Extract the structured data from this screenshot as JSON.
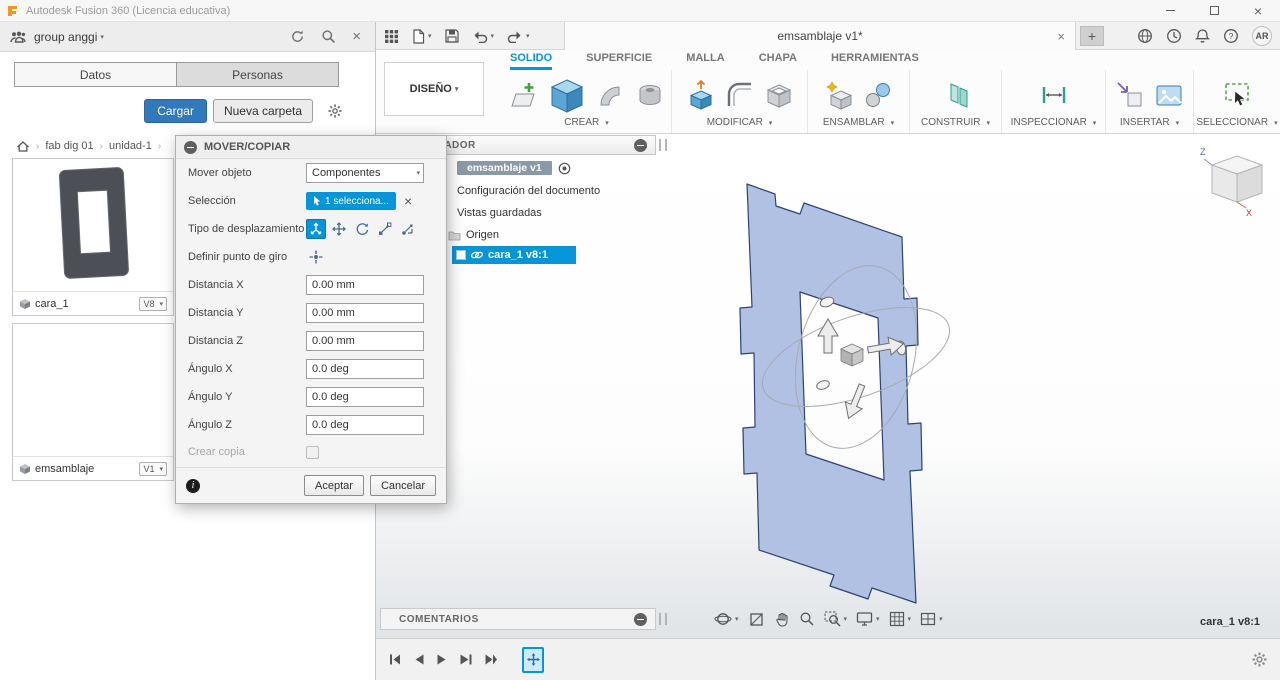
{
  "titlebar": {
    "app_title": "Autodesk Fusion 360 (Licencia educativa)"
  },
  "data_panel": {
    "team_name": "group anggi",
    "tabs": [
      {
        "label": "Datos",
        "active": true
      },
      {
        "label": "Personas",
        "active": false
      }
    ],
    "upload_button": "Cargar",
    "new_folder_button": "Nueva carpeta",
    "breadcrumb": [
      {
        "label": "fab dig 01"
      },
      {
        "label": "unidad-1"
      }
    ],
    "items": [
      {
        "name": "cara_1",
        "version": "V8"
      },
      {
        "name": "emsamblaje",
        "version": "V1"
      }
    ]
  },
  "appbar": {
    "document_tab": "emsamblaje v1*",
    "new_tab_button": "+",
    "avatar_initials": "AR"
  },
  "ribbon": {
    "workspace_selector": "DISEÑO",
    "tabs": [
      {
        "label": "SOLIDO",
        "active": true
      },
      {
        "label": "SUPERFICIE"
      },
      {
        "label": "MALLA"
      },
      {
        "label": "CHAPA"
      },
      {
        "label": "HERRAMIENTAS"
      }
    ],
    "groups": [
      {
        "label": "CREAR"
      },
      {
        "label": "MODIFICAR"
      },
      {
        "label": "ENSAMBLAR"
      },
      {
        "label": "CONSTRUIR"
      },
      {
        "label": "INSPECCIONAR"
      },
      {
        "label": "INSERTAR"
      },
      {
        "label": "SELECCIONAR"
      }
    ]
  },
  "browser": {
    "header": "NAVEGADOR",
    "root_item": {
      "label": "emsamblaje v1"
    },
    "items": [
      {
        "label": "Configuración del documento"
      },
      {
        "label": "Vistas guardadas"
      },
      {
        "label": "Origen"
      },
      {
        "label": "cara_1 v8:1",
        "selected": true
      }
    ]
  },
  "dialog": {
    "title": "MOVER/COPIAR",
    "move_object_label": "Mover objeto",
    "move_object_value": "Componentes",
    "selection_label": "Selección",
    "selection_chip": "1 selecciona...",
    "move_type_label": "Tipo de desplazamiento",
    "pivot_label": "Definir punto de giro",
    "fields": [
      {
        "label": "Distancia X",
        "value": "0.00 mm"
      },
      {
        "label": "Distancia Y",
        "value": "0.00 mm"
      },
      {
        "label": "Distancia Z",
        "value": "0.00 mm"
      },
      {
        "label": "Ángulo X",
        "value": "0.0 deg"
      },
      {
        "label": "Ángulo Y",
        "value": "0.0 deg"
      },
      {
        "label": "Ángulo Z",
        "value": "0.0 deg"
      }
    ],
    "create_copy_label": "Crear copia",
    "ok_button": "Aceptar",
    "cancel_button": "Cancelar"
  },
  "canvas": {
    "comments_label": "COMENTARIOS",
    "selected_component": "cara_1 v8:1",
    "viewcube": {
      "z_axis": "Z",
      "x_axis": "X"
    }
  },
  "icons": {
    "team": "people",
    "refresh": "circular-arrow",
    "search": "magnifier",
    "close": "x",
    "settings": "gear",
    "home": "house",
    "collapse": "circle-minus",
    "visibility": "circle-dot",
    "link": "chain",
    "document_close": "x",
    "new_tab": "plus"
  },
  "colors": {
    "accent": "#0696d7",
    "upload_button": "#3279bc",
    "part_fill": "#b0c1e4",
    "part_edge": "#2d4373",
    "selection_highlight": "#0696d7"
  }
}
